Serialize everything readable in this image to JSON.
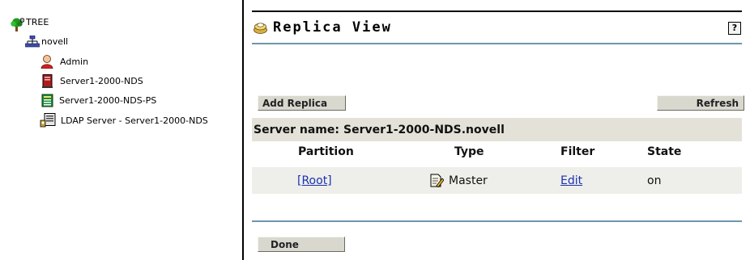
{
  "tree": {
    "root_label": "TREE",
    "org_label": "novell",
    "items": [
      {
        "label": "Admin",
        "icon": "user-icon"
      },
      {
        "label": "Server1-2000-NDS",
        "icon": "server-icon"
      },
      {
        "label": "Server1-2000-NDS-PS",
        "icon": "print-server-icon"
      },
      {
        "label": "LDAP Server - Server1-2000-NDS",
        "icon": "ldap-server-icon"
      }
    ]
  },
  "header": {
    "title": "Replica View",
    "help_label": "?"
  },
  "toolbar": {
    "add_replica_label": "Add Replica",
    "refresh_label": "Refresh"
  },
  "server": {
    "name_label": "Server name:",
    "name_value": "Server1-2000-NDS.novell"
  },
  "table": {
    "columns": [
      "Partition",
      "Type",
      "Filter",
      "State"
    ],
    "rows": [
      {
        "partition": "[Root]",
        "type": "Master",
        "filter": "Edit",
        "state": "on"
      }
    ]
  },
  "footer": {
    "done_label": "Done"
  },
  "colors": {
    "accent_rule": "#6e96ac",
    "link": "#1a33b0",
    "bar_bg": "#e4e2d8",
    "row_bg": "#eeeeea"
  }
}
